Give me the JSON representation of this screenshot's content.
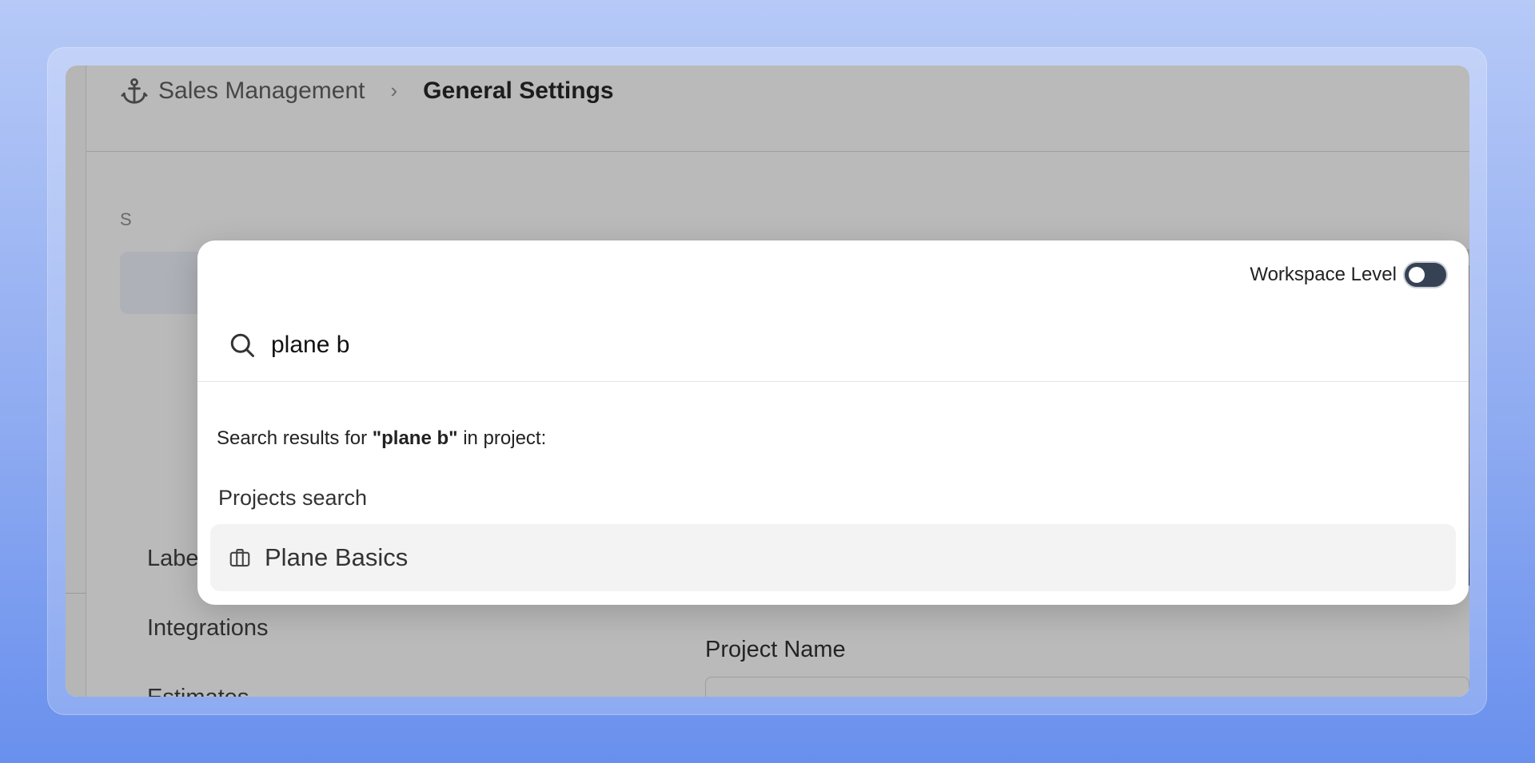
{
  "breadcrumb": {
    "parent": "Sales Management",
    "separator": "›",
    "current": "General Settings",
    "icon": "anchor-icon"
  },
  "sidebar": {
    "section_title": "S",
    "items": [
      {
        "label": "Labels"
      },
      {
        "label": "Integrations"
      },
      {
        "label": "Estimates"
      }
    ]
  },
  "main": {
    "project_name_label": "Project Name"
  },
  "search_modal": {
    "workspace_level_label": "Workspace Level",
    "workspace_level_enabled": false,
    "query": "plane b",
    "results_caption_prefix": "Search results for ",
    "results_caption_query": "\"plane b\"",
    "results_caption_suffix": " in project:",
    "group_title": "Projects search",
    "results": [
      {
        "label": "Plane Basics",
        "icon": "briefcase-icon"
      }
    ]
  },
  "colors": {
    "toggle_track": "#364153",
    "result_highlight": "#f3f3f3",
    "background_top": "#b6c9f7",
    "background_bottom": "#6990ee"
  }
}
